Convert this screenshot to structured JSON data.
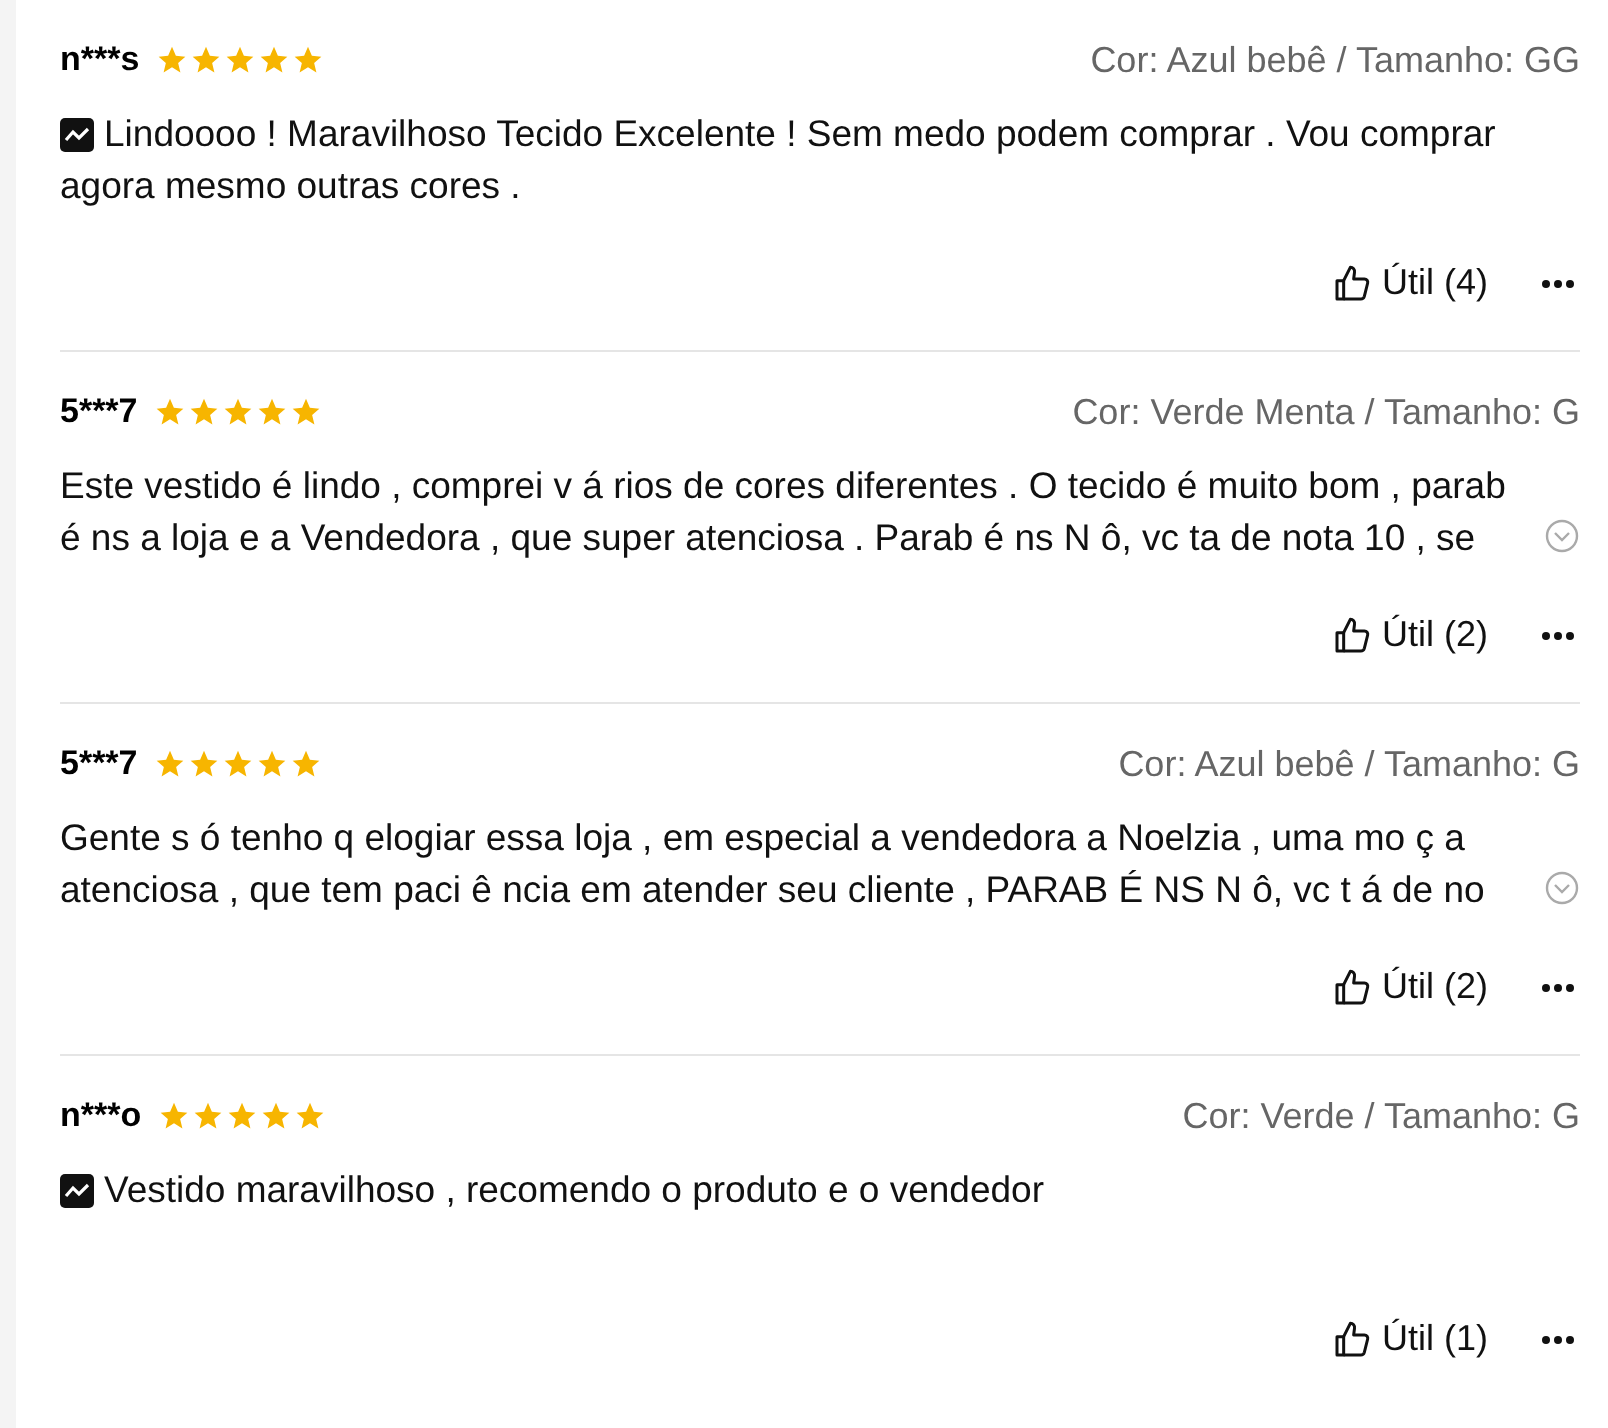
{
  "reviews": [
    {
      "user": "n***s",
      "stars": 5,
      "variant": "Cor: Azul bebê / Tamanho: GG",
      "has_image": true,
      "collapsed": false,
      "lines": [
        "Lindoooo ! Maravilhoso Tecido Excelente ! Sem medo podem comprar . Vou comprar",
        "agora mesmo outras cores ."
      ],
      "helpful": "Útil (4)"
    },
    {
      "user": "5***7",
      "stars": 5,
      "variant": "Cor: Verde Menta / Tamanho: G",
      "has_image": false,
      "collapsed": true,
      "lines": [
        "Este vestido é lindo , comprei v á rios de cores diferentes . O tecido é muito bom , parab",
        "é ns a loja e a Vendedora , que super atenciosa . Parab é ns N ô, vc ta de nota 10 , se"
      ],
      "helpful": "Útil (2)"
    },
    {
      "user": "5***7",
      "stars": 5,
      "variant": "Cor: Azul bebê / Tamanho: G",
      "has_image": false,
      "collapsed": true,
      "lines": [
        "Gente s ó tenho q elogiar essa loja , em especial a vendedora a Noelzia , uma mo ç a",
        "atenciosa , que tem paci ê ncia em atender seu cliente , PARAB É NS N ô, vc t á de no"
      ],
      "helpful": "Útil (2)"
    },
    {
      "user": "n***o",
      "stars": 5,
      "variant": "Cor: Verde / Tamanho: G",
      "has_image": true,
      "collapsed": false,
      "lines": [
        "Vestido maravilhoso , recomendo o produto e o vendedor"
      ],
      "helpful": "Útil (1)"
    }
  ]
}
